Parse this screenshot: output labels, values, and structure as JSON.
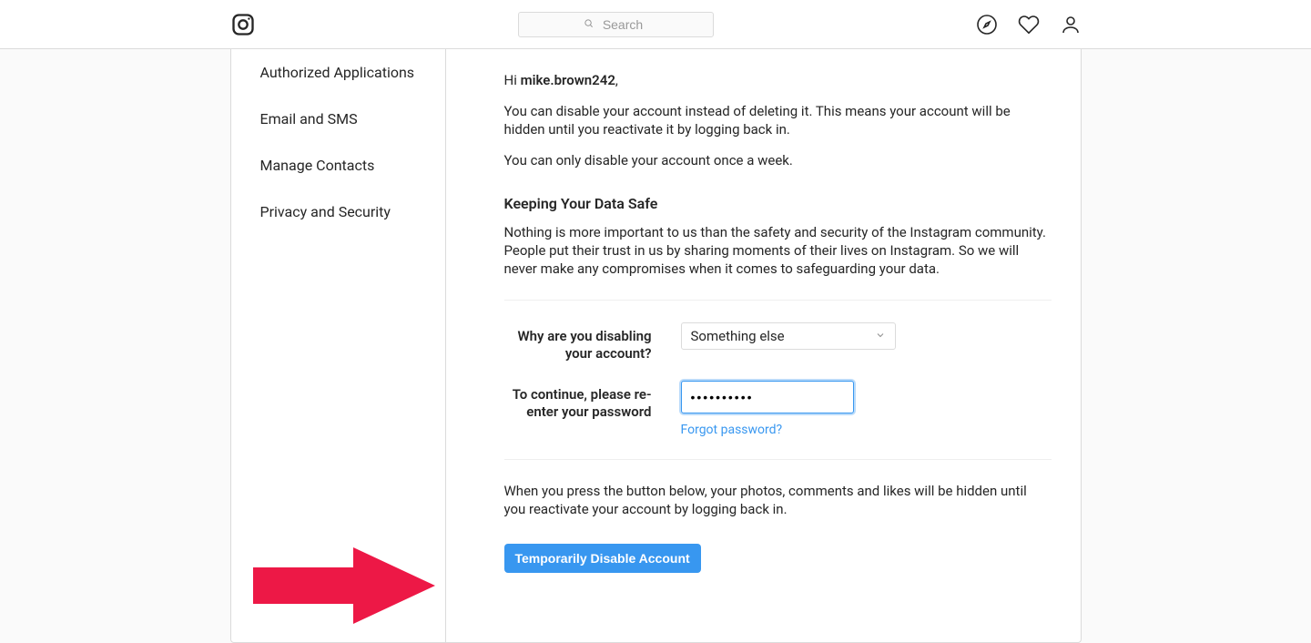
{
  "header": {
    "search_placeholder": "Search"
  },
  "sidebar": {
    "items": [
      {
        "label": "Authorized Applications"
      },
      {
        "label": "Email and SMS"
      },
      {
        "label": "Manage Contacts"
      },
      {
        "label": "Privacy and Security"
      }
    ]
  },
  "main": {
    "greeting_prefix": "Hi ",
    "username": "mike.brown242",
    "greeting_suffix": ",",
    "para1": "You can disable your account instead of deleting it. This means your account will be hidden until you reactivate it by logging back in.",
    "para2": "You can only disable your account once a week.",
    "section_title": "Keeping Your Data Safe",
    "para3": "Nothing is more important to us than the safety and security of the Instagram community. People put their trust in us by sharing moments of their lives on Instagram. So we will never make any compromises when it comes to safeguarding your data.",
    "reason_label": "Why are you disabling your account?",
    "reason_selected": "Something else",
    "password_label": "To continue, please re-enter your password",
    "password_value": "••••••••••",
    "forgot_label": "Forgot password?",
    "para4": "When you press the button below, your photos, comments and likes will be hidden until you reactivate your account by logging back in.",
    "button_label": "Temporarily Disable Account"
  }
}
